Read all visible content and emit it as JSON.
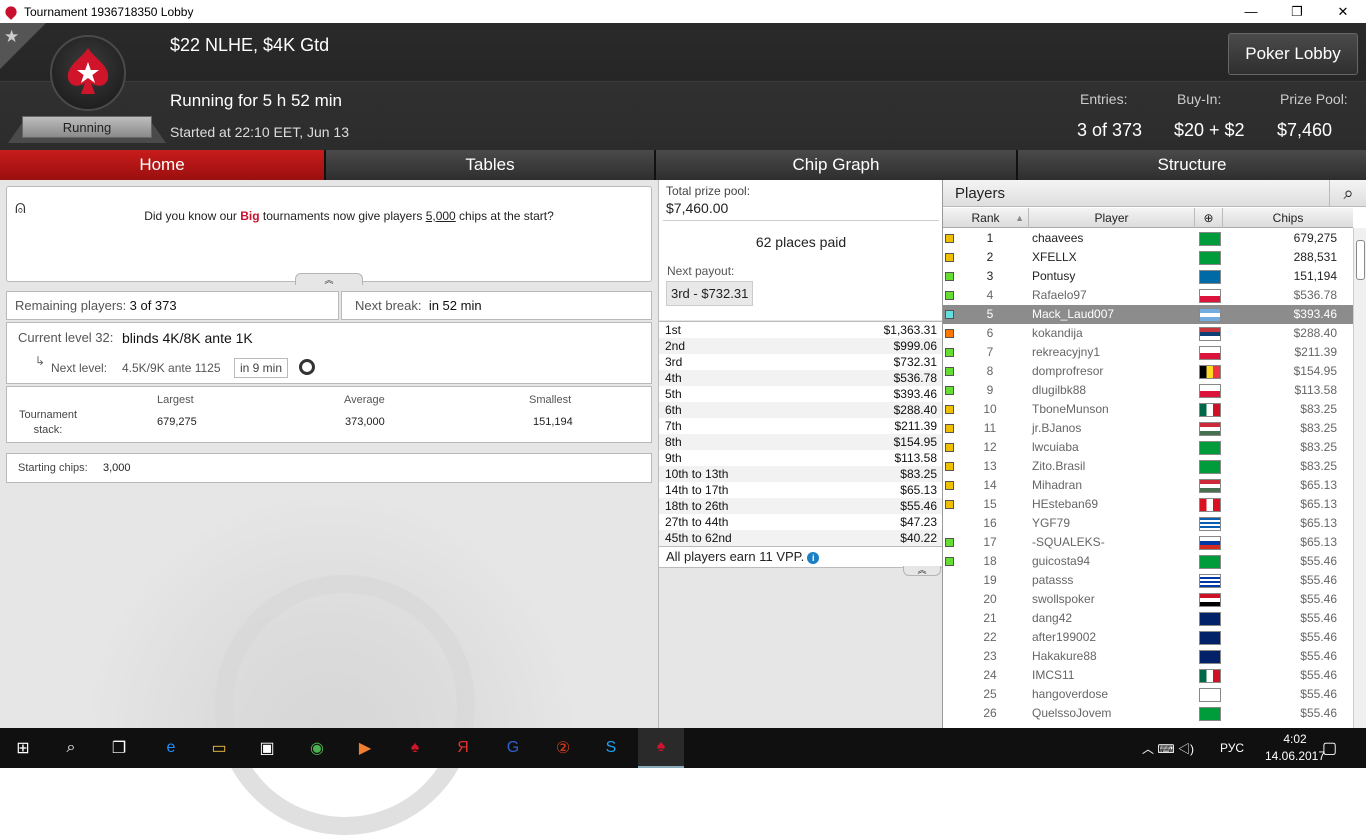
{
  "window": {
    "title": "Tournament 1936718350 Lobby",
    "minimize": "—",
    "maximize": "❐",
    "close": "✕"
  },
  "header": {
    "tournament_name": "$22 NLHE, $4K Gtd",
    "status_badge": "Running",
    "running_for": "Running for 5 h 52 min",
    "started_at": "Started at 22:10 EET, Jun 13",
    "poker_lobby_button": "Poker Lobby",
    "stats": {
      "entries_label": "Entries:",
      "entries_value": "3 of 373",
      "buyin_label": "Buy-In:",
      "buyin_value": "$20 + $2",
      "prizepool_label": "Prize Pool:",
      "prizepool_value": "$7,460"
    }
  },
  "tabs": [
    "Home",
    "Tables",
    "Chip Graph",
    "Structure"
  ],
  "tip": {
    "pre": "Did you know our ",
    "highlight": "Big",
    "mid": " tournaments now give players ",
    "underlined": "5,000",
    "post": " chips at the start?"
  },
  "remaining": {
    "label": "Remaining players:",
    "value": "3 of 373"
  },
  "next_break": {
    "label": "Next break:",
    "value": "in 52 min"
  },
  "level": {
    "current_label": "Current level 32:",
    "current_value": "blinds 4K/8K ante 1K",
    "next_label": "Next level:",
    "next_value": "4.5K/9K ante 1125",
    "next_time": "in 9 min"
  },
  "stack": {
    "label": "Tournament stack:",
    "largest_label": "Largest",
    "largest": "679,275",
    "average_label": "Average",
    "average": "373,000",
    "smallest_label": "Smallest",
    "smallest": "151,194"
  },
  "starting_chips": {
    "label": "Starting chips:",
    "value": "3,000"
  },
  "prize": {
    "total_label": "Total prize pool:",
    "total_value": "$7,460.00",
    "places_paid": "62 places paid",
    "next_payout_label": "Next payout:",
    "next_payout_value": "3rd - $732.31",
    "payouts": [
      [
        "1st",
        "$1,363.31"
      ],
      [
        "2nd",
        "$999.06"
      ],
      [
        "3rd",
        "$732.31"
      ],
      [
        "4th",
        "$536.78"
      ],
      [
        "5th",
        "$393.46"
      ],
      [
        "6th",
        "$288.40"
      ],
      [
        "7th",
        "$211.39"
      ],
      [
        "8th",
        "$154.95"
      ],
      [
        "9th",
        "$113.58"
      ],
      [
        "10th to 13th",
        "$83.25"
      ],
      [
        "14th to 17th",
        "$65.13"
      ],
      [
        "18th to 26th",
        "$55.46"
      ],
      [
        "27th to 44th",
        "$47.23"
      ],
      [
        "45th to 62nd",
        "$40.22"
      ]
    ],
    "vpp": "All players earn 11 VPP."
  },
  "players": {
    "title": "Players",
    "columns": [
      "Rank",
      "Player",
      "Chips"
    ],
    "rows": [
      {
        "rank": "1",
        "name": "chaavees",
        "chips": "679,275",
        "status": "#f0c000",
        "flag": "br"
      },
      {
        "rank": "2",
        "name": "XFELLX",
        "chips": "288,531",
        "status": "#f0c000",
        "flag": "br"
      },
      {
        "rank": "3",
        "name": "Pontusy",
        "chips": "151,194",
        "status": "#66dd33",
        "flag": "se"
      },
      {
        "rank": "4",
        "name": "Rafaelo97",
        "chips": "$536.78",
        "status": "#66dd33",
        "flag": "pl"
      },
      {
        "rank": "5",
        "name": "Mack_Laud007",
        "chips": "$393.46",
        "status": "#66dddd",
        "flag": "ar"
      },
      {
        "rank": "6",
        "name": "kokandija",
        "chips": "$288.40",
        "status": "#ff7700",
        "flag": "rs"
      },
      {
        "rank": "7",
        "name": "rekreacyjny1",
        "chips": "$211.39",
        "status": "#66dd33",
        "flag": "pl"
      },
      {
        "rank": "8",
        "name": "domprofresor",
        "chips": "$154.95",
        "status": "#66dd33",
        "flag": "be"
      },
      {
        "rank": "9",
        "name": "dlugilbk88",
        "chips": "$113.58",
        "status": "#66dd33",
        "flag": "pl"
      },
      {
        "rank": "10",
        "name": "TboneMunson",
        "chips": "$83.25",
        "status": "#f0c000",
        "flag": "mx"
      },
      {
        "rank": "11",
        "name": "jr.BJanos",
        "chips": "$83.25",
        "status": "#f0c000",
        "flag": "hu"
      },
      {
        "rank": "12",
        "name": "lwcuiaba",
        "chips": "$83.25",
        "status": "#f0c000",
        "flag": "br"
      },
      {
        "rank": "13",
        "name": "Zito.Brasil",
        "chips": "$83.25",
        "status": "#f0c000",
        "flag": "br"
      },
      {
        "rank": "14",
        "name": "Mihadran",
        "chips": "$65.13",
        "status": "#f0c000",
        "flag": "hu"
      },
      {
        "rank": "15",
        "name": "HEsteban69",
        "chips": "$65.13",
        "status": "#f0c000",
        "flag": "pe"
      },
      {
        "rank": "16",
        "name": "YGF79",
        "chips": "$65.13",
        "status": "",
        "flag": "gr"
      },
      {
        "rank": "17",
        "name": "-SQUALEKS-",
        "chips": "$65.13",
        "status": "#66dd33",
        "flag": "ru"
      },
      {
        "rank": "18",
        "name": "guicosta94",
        "chips": "$55.46",
        "status": "#66dd33",
        "flag": "br"
      },
      {
        "rank": "19",
        "name": "patasss",
        "chips": "$55.46",
        "status": "",
        "flag": "uy"
      },
      {
        "rank": "20",
        "name": "swollspoker",
        "chips": "$55.46",
        "status": "",
        "flag": "eg"
      },
      {
        "rank": "21",
        "name": "dang42",
        "chips": "$55.46",
        "status": "",
        "flag": "au"
      },
      {
        "rank": "22",
        "name": "after199002",
        "chips": "$55.46",
        "status": "",
        "flag": "gb"
      },
      {
        "rank": "23",
        "name": "Hakakure88",
        "chips": "$55.46",
        "status": "",
        "flag": "gb"
      },
      {
        "rank": "24",
        "name": "IMCS11",
        "chips": "$55.46",
        "status": "",
        "flag": "mx"
      },
      {
        "rank": "25",
        "name": "hangoverdose",
        "chips": "$55.46",
        "status": "",
        "flag": "cy"
      },
      {
        "rank": "26",
        "name": "QuelssoJovem",
        "chips": "$55.46",
        "status": "",
        "flag": "br"
      }
    ]
  },
  "taskbar": {
    "lang": "РУС",
    "time": "4:02",
    "date": "14.06.2017"
  },
  "colors": {
    "accent_red": "#c81c1c",
    "header_bg": "#2a2a2a",
    "selected_row": "#8c8c8c"
  }
}
